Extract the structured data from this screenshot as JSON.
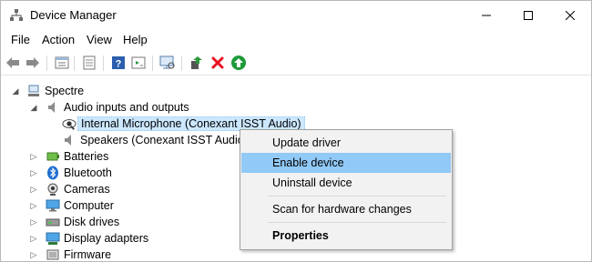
{
  "window": {
    "title": "Device Manager",
    "app_icon": "device-manager-icon"
  },
  "menu": [
    "File",
    "Action",
    "View",
    "Help"
  ],
  "toolbar": {
    "icons": [
      "back-arrow-icon",
      "forward-arrow-icon",
      "properties-icon",
      "show-hide-icon",
      "help-icon",
      "update-driver-icon",
      "scan-hardware-icon",
      "add-driver-icon",
      "uninstall-icon",
      "enable-device-icon"
    ]
  },
  "tree": {
    "root": "Spectre",
    "audio": "Audio inputs and outputs",
    "mic": "Internal Microphone (Conexant ISST Audio)",
    "speakers": "Speakers (Conexant ISST Audio)",
    "batteries": "Batteries",
    "bluetooth": "Bluetooth",
    "cameras": "Cameras",
    "computer": "Computer",
    "disk": "Disk drives",
    "display": "Display adapters",
    "firmware": "Firmware"
  },
  "context_menu": {
    "update": "Update driver",
    "enable": "Enable device",
    "uninstall": "Uninstall device",
    "scan": "Scan for hardware changes",
    "properties": "Properties"
  },
  "colors": {
    "hover": "#91c9f7",
    "selection": "#cce8ff",
    "red_x": "#e81123",
    "green": "#1e9a39"
  }
}
